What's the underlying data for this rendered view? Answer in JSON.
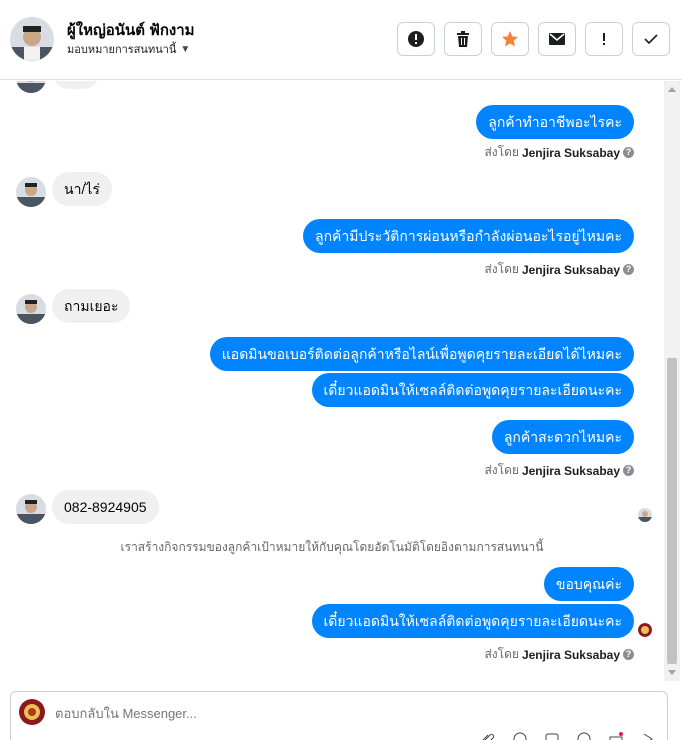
{
  "header": {
    "contact_name": "ผู้ใหญ่อนันต์ ฟักงาม",
    "assign_label": "มอบหมายการสนทนานี้",
    "actions": [
      {
        "icon": "alert-circle-icon",
        "label": "Mark as spam"
      },
      {
        "icon": "trash-icon",
        "label": "Delete"
      },
      {
        "icon": "star-icon",
        "label": "Star"
      },
      {
        "icon": "mail-icon",
        "label": "Mark as unread"
      },
      {
        "icon": "exclamation-icon",
        "label": "Follow up"
      },
      {
        "icon": "check-icon",
        "label": "Done"
      }
    ]
  },
  "messages": {
    "m1": "ลูกค้าทำอาชีพอะไรคะ",
    "m2": "นา/ไร่",
    "m3": "ลูกค้ามีประวัติการผ่อนหรือกำลังผ่อนอะไรอยู่ไหมคะ",
    "m4": "ถามเยอะ",
    "m5": "แอดมินขอเบอร์ติดต่อลูกค้าหรือไลน์เพื่อพูดคุยรายละเอียดได้ไหมคะ",
    "m6": "เดี๋ยวแอดมินให้เซลล์ติดต่อพูดคุยรายละเอียดนะคะ",
    "m7": "ลูกค้าสะดวกไหมคะ",
    "m8": "082-8924905",
    "m9": "ขอบคุณค่ะ",
    "m10": "เดี๋ยวแอดมินให้เซลล์ติดต่อพูดคุยรายละเอียดนะคะ"
  },
  "sent_by": {
    "prefix": "ส่งโดย",
    "agent": "Jenjira Suksabay"
  },
  "system_note": "เราสร้างกิจกรรมของลูกค้าเป้าหมายให้กับคุณโดยอัตโนมัติโดยอิงตามการสนทนานี้",
  "composer": {
    "placeholder": "ตอบกลับใน Messenger..."
  },
  "colors": {
    "outgoing_bubble": "#0084ff",
    "incoming_bubble": "#f0f0f0",
    "star": "#f5823a"
  }
}
